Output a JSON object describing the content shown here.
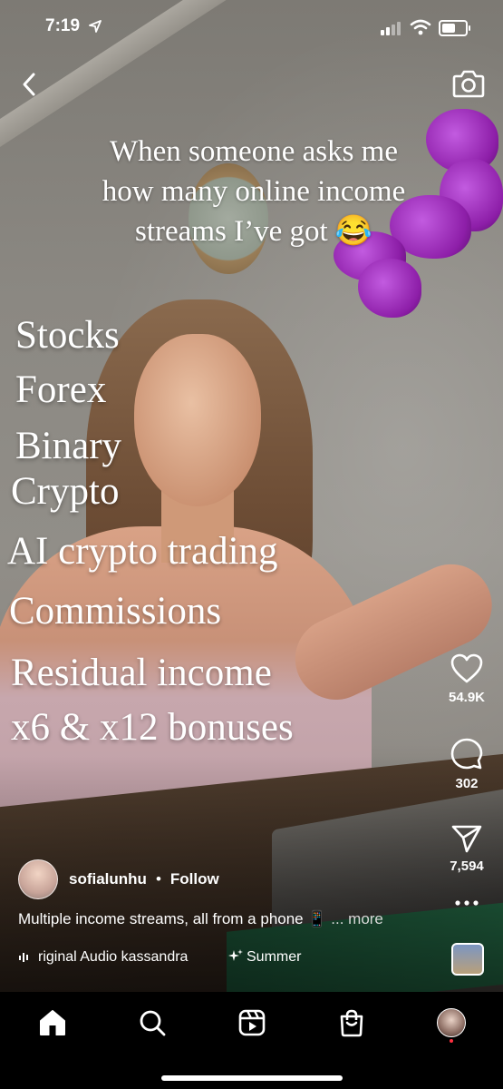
{
  "status_bar": {
    "time": "7:19"
  },
  "overlay_caption": {
    "lines": [
      "When someone asks me",
      "how many online income",
      "streams I’ve got 😂"
    ]
  },
  "income_list": [
    "Stocks",
    "Forex",
    "Binary",
    "Crypto",
    "AI crypto trading",
    "Commissions",
    "Residual income",
    "x6 & x12 bonuses"
  ],
  "actions": {
    "likes": "54.9K",
    "comments": "302",
    "shares": "7,594"
  },
  "post": {
    "username": "sofialunhu",
    "separator": "•",
    "follow_label": "Follow",
    "description": "Multiple income streams, all from a phone 📱",
    "more_label": "... more",
    "audio": "riginal Audio  kassandra",
    "effect": "Summer"
  },
  "colors": {
    "accent": "#ffffff",
    "notification": "#ff3040",
    "tabbar": "#000000"
  },
  "icons": {
    "back": "chevron-left-icon",
    "camera": "camera-icon",
    "like": "heart-icon",
    "comment": "comment-icon",
    "share": "paper-plane-icon",
    "more": "more-dots-icon",
    "home": "home-icon",
    "search": "search-icon",
    "reels": "reels-icon",
    "shop": "shopping-bag-icon"
  }
}
